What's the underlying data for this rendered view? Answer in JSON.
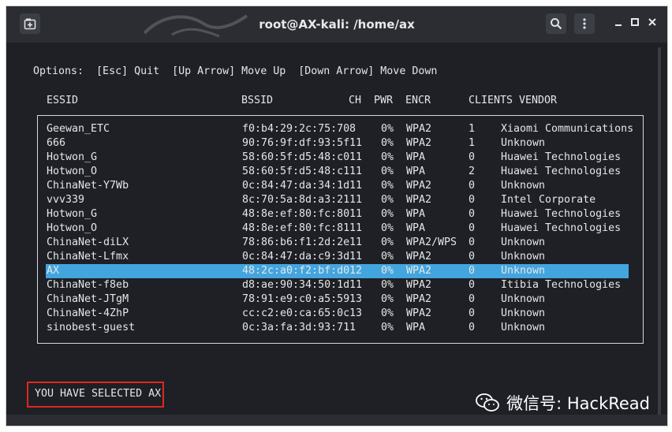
{
  "window": {
    "title": "root@AX-kali: /home/ax"
  },
  "terminal": {
    "options_text": "Options:  [Esc] Quit  [Up Arrow] Move Up  [Down Arrow] Move Down",
    "columns": {
      "essid": "ESSID",
      "bssid": "BSSID",
      "ch": "CH",
      "pwr": "PWR",
      "encr": "ENCR",
      "clients": "CLIENTS",
      "vendor": "VENDOR"
    },
    "rows": [
      {
        "essid": "Geewan_ETC",
        "bssid": "f0:b4:29:2c:75:70",
        "ch": "8",
        "pwr": "0%",
        "encr": "WPA2",
        "clients": "1",
        "vendor": "Xiaomi Communications"
      },
      {
        "essid": "666",
        "bssid": "90:76:9f:df:93:5f",
        "ch": "11",
        "pwr": "0%",
        "encr": "WPA2",
        "clients": "1",
        "vendor": "Unknown"
      },
      {
        "essid": "Hotwon_G",
        "bssid": "58:60:5f:d5:48:c0",
        "ch": "11",
        "pwr": "0%",
        "encr": "WPA",
        "clients": "0",
        "vendor": "Huawei Technologies"
      },
      {
        "essid": "Hotwon_O",
        "bssid": "58:60:5f:d5:48:c1",
        "ch": "11",
        "pwr": "0%",
        "encr": "WPA",
        "clients": "2",
        "vendor": "Huawei Technologies"
      },
      {
        "essid": "ChinaNet-Y7Wb",
        "bssid": "0c:84:47:da:34:1d",
        "ch": "11",
        "pwr": "0%",
        "encr": "WPA2",
        "clients": "0",
        "vendor": "Unknown"
      },
      {
        "essid": "vvv339",
        "bssid": "8c:70:5a:8d:a3:21",
        "ch": "11",
        "pwr": "0%",
        "encr": "WPA2",
        "clients": "0",
        "vendor": "Intel Corporate"
      },
      {
        "essid": "Hotwon_G",
        "bssid": "48:8e:ef:80:fc:80",
        "ch": "11",
        "pwr": "0%",
        "encr": "WPA",
        "clients": "0",
        "vendor": "Huawei Technologies"
      },
      {
        "essid": "Hotwon_O",
        "bssid": "48:8e:ef:80:fc:81",
        "ch": "11",
        "pwr": "0%",
        "encr": "WPA",
        "clients": "0",
        "vendor": "Huawei Technologies"
      },
      {
        "essid": "ChinaNet-diLX",
        "bssid": "78:86:b6:f1:2d:2e",
        "ch": "11",
        "pwr": "0%",
        "encr": "WPA2/WPS",
        "clients": "0",
        "vendor": "Unknown"
      },
      {
        "essid": "ChinaNet-Lfmx",
        "bssid": "0c:84:47:da:c9:3d",
        "ch": "11",
        "pwr": "0%",
        "encr": "WPA2",
        "clients": "0",
        "vendor": "Unknown"
      },
      {
        "essid": "AX",
        "bssid": "48:2c:a0:f2:bf:d0",
        "ch": "12",
        "pwr": "0%",
        "encr": "WPA2",
        "clients": "0",
        "vendor": "Unknown",
        "selected": true
      },
      {
        "essid": "ChinaNet-f8eb",
        "bssid": "d8:ae:90:34:50:1d",
        "ch": "11",
        "pwr": "0%",
        "encr": "WPA2",
        "clients": "0",
        "vendor": "Itibia Technologies"
      },
      {
        "essid": "ChinaNet-JTgM",
        "bssid": "78:91:e9:c0:a5:59",
        "ch": "13",
        "pwr": "0%",
        "encr": "WPA2",
        "clients": "0",
        "vendor": "Unknown"
      },
      {
        "essid": "ChinaNet-4ZhP",
        "bssid": "cc:c2:e0:ca:65:0c",
        "ch": "13",
        "pwr": "0%",
        "encr": "WPA2",
        "clients": "0",
        "vendor": "Unknown"
      },
      {
        "essid": "sinobest-guest",
        "bssid": "0c:3a:fa:3d:93:71",
        "ch": "1",
        "pwr": "0%",
        "encr": "WPA",
        "clients": "0",
        "vendor": "Unknown"
      }
    ],
    "status_text": "YOU HAVE SELECTED AX"
  },
  "watermark": {
    "text": "微信号: HackRead"
  },
  "colors": {
    "selection": "#43a5de",
    "highlight_box": "#e0271f",
    "terminal_bg": "#1e2026"
  }
}
